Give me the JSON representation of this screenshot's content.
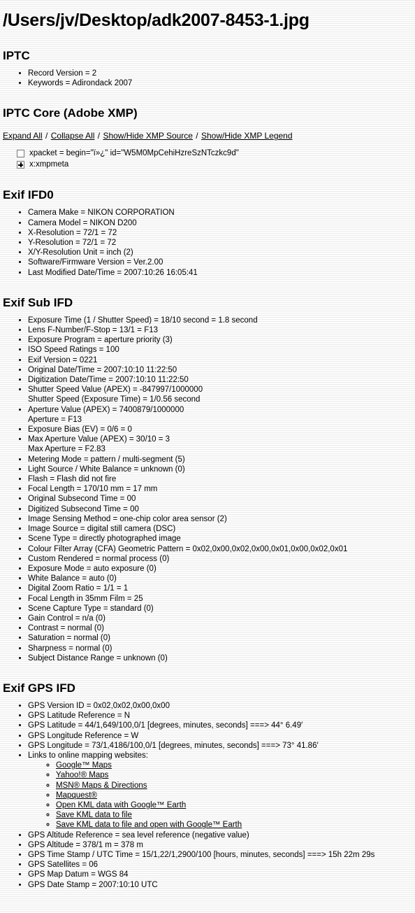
{
  "document": {
    "title": "/Users/jv/Desktop/adk2007-8453-1.jpg"
  },
  "sections": {
    "iptc": {
      "heading": "IPTC",
      "items": [
        "Record Version = 2",
        "Keywords = Adirondack 2007"
      ]
    },
    "iptc_core": {
      "heading": "IPTC Core (Adobe XMP)",
      "links": [
        "Expand All",
        "Collapse All",
        "Show/Hide XMP Source",
        "Show/Hide XMP Legend"
      ],
      "separator": "/",
      "tree": [
        {
          "toggle": "empty-checkbox",
          "label": "xpacket = begin=\"ï»¿\" id=\"W5M0MpCehiHzreSzNTczkc9d\""
        },
        {
          "toggle": "plus-expander",
          "label": "x:xmpmeta"
        }
      ]
    },
    "exif_ifd0": {
      "heading": "Exif IFD0",
      "items": [
        "Camera Make = NIKON CORPORATION",
        "Camera Model = NIKON D200",
        "X-Resolution = 72/1 = 72",
        "Y-Resolution = 72/1 = 72",
        "X/Y-Resolution Unit = inch (2)",
        "Software/Firmware Version = Ver.2.00",
        "Last Modified Date/Time = 2007:10:26 16:05:41"
      ]
    },
    "exif_sub_ifd": {
      "heading": "Exif Sub IFD",
      "items": [
        "Exposure Time (1 / Shutter Speed) = 18/10 second = 1.8 second",
        "Lens F-Number/F-Stop = 13/1 = F13",
        "Exposure Program = aperture priority (3)",
        "ISO Speed Ratings = 100",
        "Exif Version = 0221",
        "Original Date/Time = 2007:10:10 11:22:50",
        "Digitization Date/Time = 2007:10:10 11:22:50",
        "Shutter Speed Value (APEX) = -847997/1000000",
        "Aperture Value (APEX) = 7400879/1000000",
        "Exposure Bias (EV) = 0/6 = 0",
        "Max Aperture Value (APEX) = 30/10 = 3",
        "Metering Mode = pattern / multi-segment (5)",
        "Light Source / White Balance = unknown (0)",
        "Flash = Flash did not fire",
        "Focal Length = 170/10 mm = 17 mm",
        "Original Subsecond Time = 00",
        "Digitized Subsecond Time = 00",
        "Image Sensing Method = one-chip color area sensor (2)",
        "Image Source = digital still camera (DSC)",
        "Scene Type = directly photographed image",
        "Colour Filter Array (CFA) Geometric Pattern = 0x02,0x00,0x02,0x00,0x01,0x00,0x02,0x01",
        "Custom Rendered = normal process (0)",
        "Exposure Mode = auto exposure (0)",
        "White Balance = auto (0)",
        "Digital Zoom Ratio = 1/1 = 1",
        "Focal Length in 35mm Film = 25",
        "Scene Capture Type = standard (0)",
        "Gain Control = n/a (0)",
        "Contrast = normal (0)",
        "Saturation = normal (0)",
        "Sharpness = normal (0)",
        "Subject Distance Range = unknown (0)"
      ],
      "continuations": {
        "7": "Shutter Speed (Exposure Time) = 1/0.56 second",
        "8": "Aperture = F13",
        "10": "Max Aperture = F2.83"
      }
    },
    "exif_gps_ifd": {
      "heading": "Exif GPS IFD",
      "items_before_links": [
        "GPS Version ID = 0x02,0x02,0x00,0x00",
        "GPS Latitude Reference = N",
        "GPS Latitude = 44/1,649/100,0/1 [degrees, minutes, seconds] ===> 44° 6.49′",
        "GPS Longitude Reference = W",
        "GPS Longitude = 73/1,4186/100,0/1 [degrees, minutes, seconds] ===> 73° 41.86′"
      ],
      "links_label": "Links to online mapping websites:",
      "map_links": [
        "Google™ Maps",
        "Yahoo!® Maps",
        "MSN® Maps & Directions",
        "Mapquest®",
        "Open KML data with Google™ Earth",
        "Save KML data to file",
        "Save KML data to file and open with Google™ Earth"
      ],
      "items_after_links": [
        "GPS Altitude Reference = sea level reference (negative value)",
        "GPS Altitude = 378/1 m = 378 m",
        "GPS Time Stamp / UTC Time = 15/1,22/1,2900/100 [hours, minutes, seconds] ===> 15h 22m 29s",
        "GPS Satellites = 06",
        "GPS Map Datum = WGS 84",
        "GPS Date Stamp = 2007:10:10 UTC"
      ]
    }
  },
  "colors": {
    "text": "#000000",
    "link": "#000000",
    "background": "#ffffff",
    "stripe": "#ececec"
  }
}
